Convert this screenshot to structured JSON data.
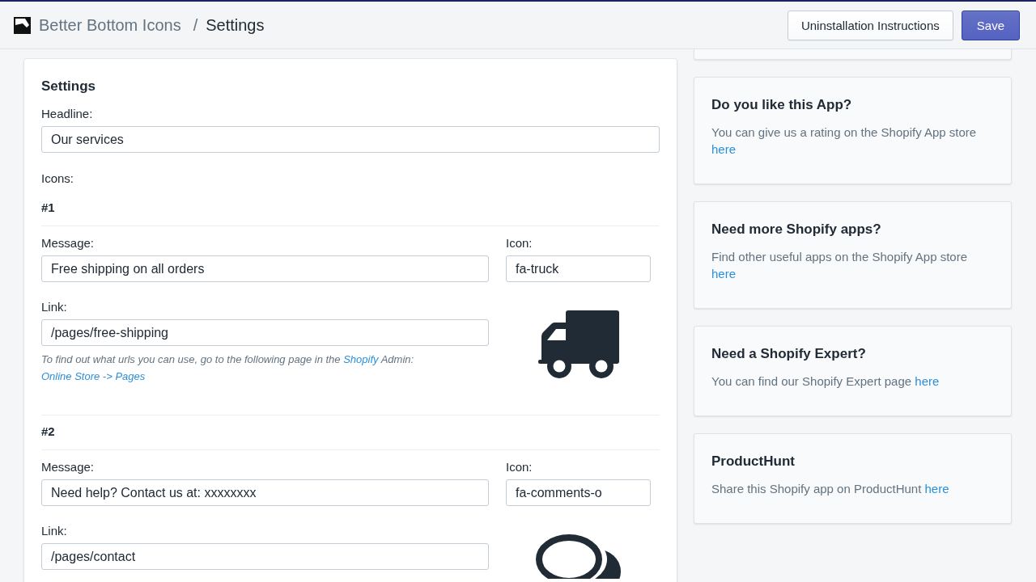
{
  "header": {
    "breadcrumb": "Better Bottom Icons",
    "separator": "/",
    "title": "Settings",
    "buttons": [
      {
        "label": "Uninstallation Instructions",
        "kind": "secondary"
      },
      {
        "label": "Save",
        "kind": "primary"
      }
    ]
  },
  "settings": {
    "title": "Settings",
    "headline": {
      "label": "Headline:",
      "value": "Our services"
    },
    "icons_label": "Icons:",
    "icons": [
      {
        "number": "#1",
        "kind": "truck",
        "message": {
          "label": "Message:",
          "value": "Free shipping on all orders"
        },
        "icon": {
          "label": "Icon:",
          "value": "fa-truck"
        },
        "link": {
          "label": "Link:",
          "value": "/pages/free-shipping"
        },
        "hint": [
          {
            "kind": "text",
            "text": "To find out what urls you can use, go to the following page in the "
          },
          {
            "kind": "link",
            "text": "Shopify"
          },
          {
            "kind": "text",
            "text": " Admin: "
          },
          {
            "kind": "link",
            "text": "Online Store -> Pages"
          }
        ]
      },
      {
        "number": "#2",
        "kind": "comments",
        "message": {
          "label": "Message:",
          "value": "Need help? Contact us at: xxxxxxxx"
        },
        "icon": {
          "label": "Icon:",
          "value": "fa-comments-o"
        },
        "link": {
          "label": "Link:",
          "value": "/pages/contact"
        }
      }
    ]
  },
  "sidebar": {
    "cards": [
      {
        "title": "Do you like this App?",
        "text": "You can give us a rating on the Shopify App store",
        "link": "here"
      },
      {
        "title": "Need more Shopify apps?",
        "text": "Find other useful apps on the Shopify App store",
        "link": "here"
      },
      {
        "title": "Need a Shopify Expert?",
        "text": "You can find our Shopify Expert page",
        "link": "here"
      },
      {
        "title": "ProductHunt",
        "text": "Share this Shopify app on ProductHunt",
        "link": "here"
      }
    ]
  }
}
